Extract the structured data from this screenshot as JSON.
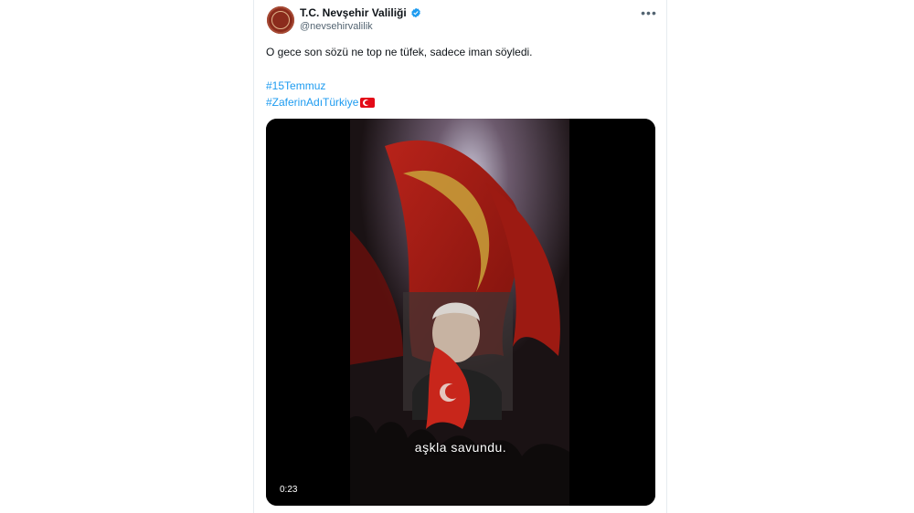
{
  "account": {
    "display_name": "T.C. Nevşehir Valiliği",
    "handle": "@nevsehirvalilik"
  },
  "tweet": {
    "text": "O gece son sözü ne top ne tüfek, sadece iman söyledi.",
    "hashtags": [
      "#15Temmuz",
      "#ZaferinAdıTürkiye"
    ]
  },
  "media": {
    "subtitle": "aşkla savundu.",
    "duration": "0:23"
  },
  "icons": {
    "more": "more-icon",
    "verified": "verified-badge-icon",
    "flag": "turkish-flag-emoji"
  },
  "colors": {
    "link": "#1d9bf0",
    "verified": "#1d9bf0",
    "flag_red": "#e30a17"
  }
}
